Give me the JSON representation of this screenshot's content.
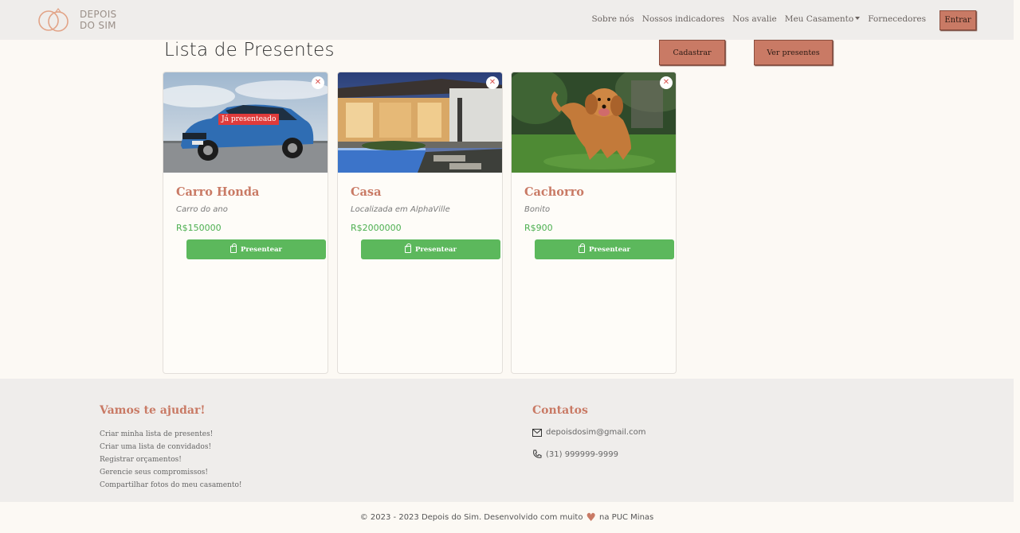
{
  "brand": {
    "line1": "DEPOIS",
    "line2": "DO SIM"
  },
  "nav": {
    "items": [
      "Sobre nós",
      "Nossos indicadores",
      "Nos avalie",
      "Meu Casamento",
      "Fornecedores"
    ],
    "login": "Entrar"
  },
  "page": {
    "title": "Lista de Presentes",
    "register_button": "Cadastrar",
    "view_button": "Ver presentes"
  },
  "gifts": [
    {
      "title": "Carro Honda",
      "description": "Carro do ano",
      "price": "R$150000",
      "badge": "Já presenteado",
      "button": "Presentear",
      "close": "✕"
    },
    {
      "title": "Casa",
      "description": "Localizada em AlphaVille",
      "price": "R$2000000",
      "button": "Presentear",
      "close": "✕"
    },
    {
      "title": "Cachorro",
      "description": "Bonito",
      "price": "R$900",
      "button": "Presentear",
      "close": "✕"
    }
  ],
  "footer": {
    "help_title": "Vamos te ajudar!",
    "help_links": [
      "Criar minha lista de presentes!",
      "Criar uma lista de convidados!",
      "Registrar orçamentos!",
      "Gerencie seus compromissos!",
      "Compartilhar fotos do meu casamento!"
    ],
    "contacts_title": "Contatos",
    "email": "depoisdosim@gmail.com",
    "phone": "(31) 999999-9999",
    "copyright_before": "© 2023 - 2023 Depois do Sim. Desenvolvido com muito",
    "copyright_after": "na PUC Minas"
  },
  "colors": {
    "accent": "#c97a65",
    "success": "#5cb85c",
    "danger": "#e03b3b",
    "background": "#fcf9f4",
    "navbar": "#efedeb"
  }
}
